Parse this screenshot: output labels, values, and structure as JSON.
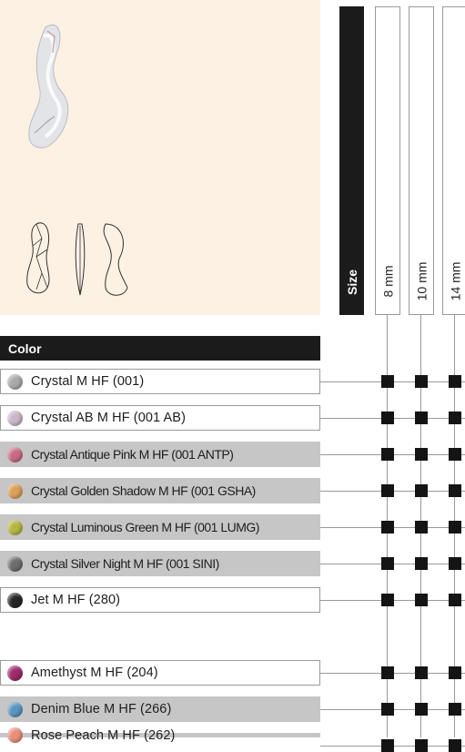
{
  "size_header": {
    "label": "Size"
  },
  "sizes": [
    "8 mm",
    "10 mm",
    "14 mm"
  ],
  "color_header": {
    "label": "Color"
  },
  "colors": [
    {
      "name": "Crystal M HF (001)",
      "swatch": "#a9a9a9",
      "shaded": false
    },
    {
      "name": "Crystal AB M HF (001 AB)",
      "swatch": "#c9b6c7",
      "shaded": false
    },
    {
      "name": "Crystal Antique Pink M HF (001 ANTP)",
      "swatch": "#c86c86",
      "shaded": true
    },
    {
      "name": "Crystal Golden Shadow M HF (001 GSHA)",
      "swatch": "#d9a15a",
      "shaded": true
    },
    {
      "name": "Crystal Luminous Green M HF (001 LUMG)",
      "swatch": "#b5b641",
      "shaded": true
    },
    {
      "name": "Crystal Silver Night M HF (001 SINI)",
      "swatch": "#6d6d6d",
      "shaded": true
    },
    {
      "name": "Jet M HF (280)",
      "swatch": "#262626",
      "shaded": false
    },
    {
      "name": "Amethyst M HF (204)",
      "swatch": "#9c2a6a",
      "shaded": false
    },
    {
      "name": "Denim Blue M HF (266)",
      "swatch": "#5a95bf",
      "shaded": true
    },
    {
      "name": "Rose Peach M HF (262)",
      "swatch": "#e98e7a",
      "shaded": true
    }
  ]
}
